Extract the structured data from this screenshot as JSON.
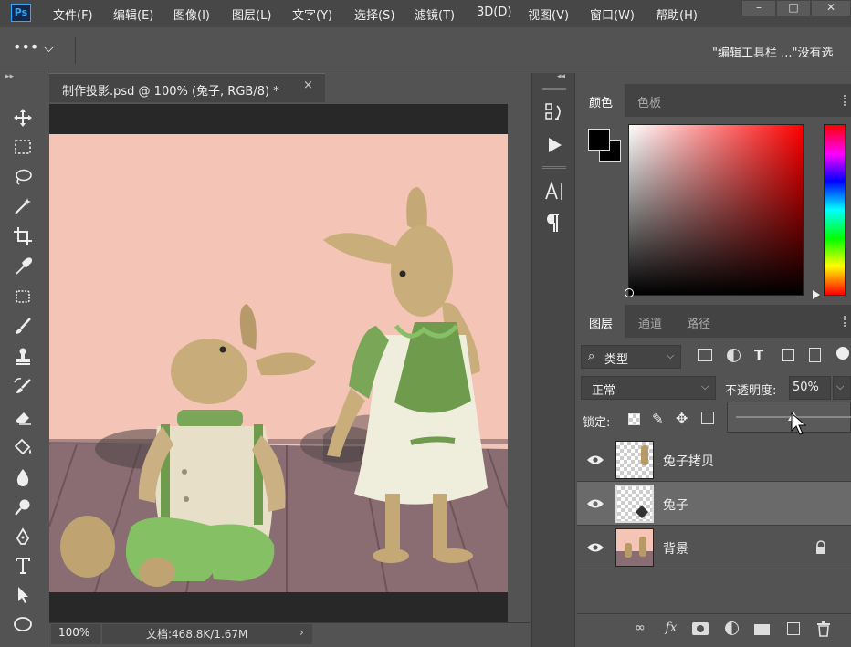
{
  "app": {
    "logo": "Ps"
  },
  "menu": [
    "文件(F)",
    "编辑(E)",
    "图像(I)",
    "图层(L)",
    "文字(Y)",
    "选择(S)",
    "滤镜(T)",
    "3D(D)",
    "视图(V)",
    "窗口(W)",
    "帮助(H)"
  ],
  "window_controls": {
    "minimize": "–",
    "restore": "□",
    "close": "✕"
  },
  "options_bar": {
    "more": "••• ⌵",
    "hint": "\"编辑工具栏 ...\"没有选"
  },
  "document": {
    "tab_title": "制作投影.psd @ 100% (兔子, RGB/8) *",
    "close": "×",
    "zoom": "100%",
    "doc_info": "文档:468.8K/1.67M",
    "status_arrow": "›"
  },
  "tools": [
    "move-tool",
    "marquee-tool",
    "lasso-tool",
    "magic-wand-tool",
    "crop-tool",
    "eyedropper-tool",
    "patch-tool",
    "brush-tool",
    "stamp-tool",
    "history-brush-tool",
    "eraser-tool",
    "paint-bucket-tool",
    "blur-tool",
    "dodge-tool",
    "pen-tool",
    "type-tool",
    "path-select-tool",
    "ellipse-tool"
  ],
  "color_panel": {
    "tabs": [
      "颜色",
      "色板"
    ],
    "foreground": "#000000",
    "background": "#000000",
    "hue_color": "#ff0000"
  },
  "layers_panel": {
    "tabs": [
      "图层",
      "通道",
      "路径"
    ],
    "filter": "类型",
    "blend_mode": "正常",
    "opacity_label": "不透明度:",
    "opacity_value": "50%",
    "opacity_fraction": 0.5,
    "lock_label": "锁定:",
    "layers": [
      {
        "name": "兔子拷贝",
        "visible": true,
        "selected": false,
        "locked": false
      },
      {
        "name": "兔子",
        "visible": true,
        "selected": true,
        "locked": false
      },
      {
        "name": "背景",
        "visible": true,
        "selected": false,
        "locked": true
      }
    ],
    "footer": [
      "link-icon",
      "fx-icon",
      "mask-icon",
      "adjustment-icon",
      "folder-icon",
      "new-layer-icon",
      "trash-icon"
    ],
    "fx_label": "fx"
  }
}
